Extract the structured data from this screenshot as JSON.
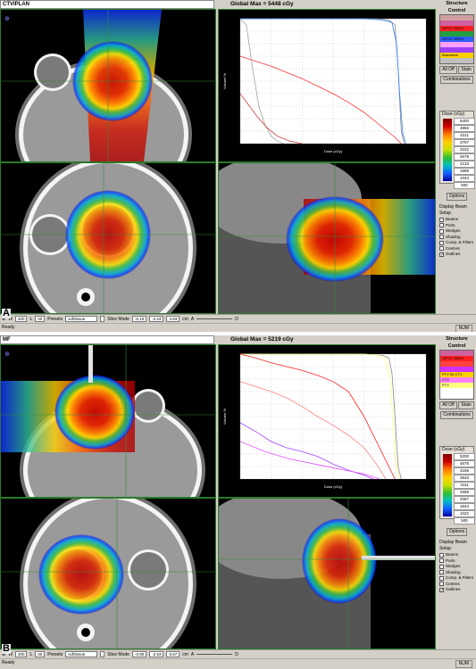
{
  "panels": [
    {
      "id": "A",
      "label": "A",
      "title": "CTVIPLAN",
      "global_max_label": "Global Max =",
      "global_max_value": "5448 cGy",
      "structure_control": "Structure Control",
      "structures": [
        {
          "name": "",
          "color": "#d0a0a0"
        },
        {
          "name": "",
          "color": "#d060a0"
        },
        {
          "name": "OPTIC NERV",
          "color": "#ff2020"
        },
        {
          "name": "",
          "color": "#20a040"
        },
        {
          "name": "OPTIC NERV",
          "color": "#3060ff"
        },
        {
          "name": "",
          "color": "#ffa0ff"
        },
        {
          "name": "",
          "color": "#a040ff"
        },
        {
          "name": "Brainstem",
          "color": "#ffd000"
        },
        {
          "name": "",
          "color": "#c0c0c0"
        },
        {
          "name": "",
          "color": "#ff8000"
        }
      ],
      "buttons": {
        "all_off": "All Off",
        "stats": "Stats",
        "combinations": "Combinations",
        "options": "Options"
      },
      "dose_title": "Dose (cGy)",
      "dose_levels": [
        "5400",
        "4856",
        "4311",
        "3767",
        "3222",
        "2678",
        "2133",
        "1589",
        "1044",
        "500"
      ],
      "beam_setup_title": "Display Beam Setup",
      "beam_options": [
        {
          "label": "Beams",
          "checked": false
        },
        {
          "label": "Ports",
          "checked": false
        },
        {
          "label": "Wedges",
          "checked": false
        },
        {
          "label": "Shading",
          "checked": false
        },
        {
          "label": "Comp. & Filters",
          "checked": false
        },
        {
          "label": "Centres",
          "checked": false
        },
        {
          "label": "Outlines",
          "checked": true
        }
      ],
      "controls": {
        "w_label": "W",
        "w_value": "400",
        "l_label": "L",
        "l_value": "40",
        "presets_label": "Presets",
        "preset_value": "softtissue",
        "slice_mode": "Slice Mode",
        "v1": "-5.10",
        "v2": "-2.24",
        "v3": "4.93",
        "unit": "cm",
        "a": "A",
        "d": "D"
      },
      "status": "Ready",
      "num": "NUM",
      "chart_data": {
        "type": "line",
        "xlabel": "Dose (cGy)",
        "ylabel": "Volume %",
        "ylim": [
          0,
          100
        ],
        "xlim": [
          0,
          6000
        ],
        "series": [
          {
            "color": "#ffffff",
            "x": [
              0,
              1000,
              1500,
              2000,
              2500,
              3000,
              4000,
              4400,
              4800,
              5000,
              5100,
              5200,
              5300
            ],
            "y": [
              100,
              100,
              100,
              100,
              100,
              100,
              100,
              100,
              99,
              95,
              60,
              10,
              0
            ]
          },
          {
            "color": "#3080ff",
            "x": [
              0,
              3000,
              4000,
              4600,
              4900,
              5050,
              5150,
              5250,
              5350
            ],
            "y": [
              100,
              100,
              100,
              99,
              97,
              80,
              40,
              8,
              0
            ]
          },
          {
            "color": "#ff3030",
            "x": [
              0,
              500,
              1000,
              1500,
              2000,
              2500,
              3000,
              3500,
              4000,
              4500,
              5000,
              5200
            ],
            "y": [
              70,
              66,
              62,
              57,
              52,
              46,
              40,
              33,
              25,
              15,
              5,
              0
            ]
          },
          {
            "color": "#a0a0a0",
            "x": [
              0,
              200,
              400,
              600,
              800,
              1000,
              1200,
              1400
            ],
            "y": [
              100,
              95,
              60,
              30,
              15,
              6,
              2,
              0
            ]
          },
          {
            "color": "#d04040",
            "x": [
              0,
              300,
              600,
              900,
              1200,
              1600,
              2000
            ],
            "y": [
              40,
              30,
              20,
              12,
              6,
              2,
              0
            ]
          }
        ]
      }
    },
    {
      "id": "B",
      "label": "B",
      "title": "MF",
      "global_max_label": "Global Max =",
      "global_max_value": "5219 cGy",
      "structure_control": "Structure Control",
      "structures": [
        {
          "name": "",
          "color": "#d060a0"
        },
        {
          "name": "OPTIC NERV",
          "color": "#ff2020"
        },
        {
          "name": "",
          "color": "#ff4040"
        },
        {
          "name": "",
          "color": "#d030ff"
        },
        {
          "name": "PTV 50-CTV",
          "color": "#ffd000"
        },
        {
          "name": "CTV",
          "color": "#ff80ff"
        },
        {
          "name": "PTV",
          "color": "#ffff80"
        }
      ],
      "buttons": {
        "all_off": "All Off",
        "stats": "Stats",
        "combinations": "Combinations",
        "options": "Options"
      },
      "dose_title": "Dose (cGy)",
      "dose_levels": [
        "5200",
        "4678",
        "4156",
        "3633",
        "3111",
        "2589",
        "2067",
        "1544",
        "1022",
        "500"
      ],
      "beam_setup_title": "Display Beam Setup",
      "beam_options": [
        {
          "label": "Beams",
          "checked": false
        },
        {
          "label": "Ports",
          "checked": false
        },
        {
          "label": "Wedges",
          "checked": false
        },
        {
          "label": "Shading",
          "checked": false
        },
        {
          "label": "Comp. & Filters",
          "checked": false
        },
        {
          "label": "Centres",
          "checked": false
        },
        {
          "label": "Outlines",
          "checked": true
        }
      ],
      "controls": {
        "w_label": "W",
        "w_value": "400",
        "l_label": "L",
        "l_value": "40",
        "presets_label": "Presets",
        "preset_value": "softtissue",
        "slice_mode": "Slice Mode",
        "v1": "-3.90",
        "v2": "-2.53",
        "v3": "5.67",
        "unit": "cm",
        "a": "A",
        "d": "D"
      },
      "status": "Ready",
      "num": "NUM",
      "chart_data": {
        "type": "line",
        "xlabel": "Dose (cGy)",
        "ylabel": "Volume %",
        "ylim": [
          0,
          100
        ],
        "xlim": [
          0,
          6000
        ],
        "series": [
          {
            "color": "#ffffff",
            "x": [
              0,
              4000,
              4600,
              4800,
              4900,
              5000,
              5100,
              5200
            ],
            "y": [
              100,
              100,
              99,
              97,
              85,
              50,
              10,
              0
            ]
          },
          {
            "color": "#ffff80",
            "x": [
              0,
              4000,
              4500,
              4700,
              4850,
              4950,
              5050,
              5150
            ],
            "y": [
              100,
              100,
              99,
              95,
              80,
              40,
              8,
              0
            ]
          },
          {
            "color": "#ff2020",
            "x": [
              0,
              500,
              1000,
              1500,
              2000,
              2500,
              3000,
              3500,
              4000,
              4500,
              4800,
              5000
            ],
            "y": [
              100,
              97,
              93,
              90,
              87,
              83,
              78,
              70,
              50,
              25,
              10,
              0
            ]
          },
          {
            "color": "#ff8080",
            "x": [
              0,
              1000,
              1500,
              2000,
              2500,
              3000,
              3500,
              4000,
              4400,
              4700
            ],
            "y": [
              78,
              70,
              65,
              58,
              50,
              43,
              35,
              25,
              12,
              0
            ]
          },
          {
            "color": "#a040ff",
            "x": [
              0,
              500,
              1000,
              1500,
              2000,
              2500,
              3000,
              3500,
              4000,
              4300
            ],
            "y": [
              45,
              38,
              30,
              25,
              22,
              18,
              12,
              7,
              3,
              0
            ]
          },
          {
            "color": "#e050ff",
            "x": [
              0,
              800,
              1600,
              2400,
              3200,
              4000,
              4500
            ],
            "y": [
              30,
              22,
              16,
              12,
              8,
              4,
              0
            ]
          }
        ]
      }
    }
  ]
}
